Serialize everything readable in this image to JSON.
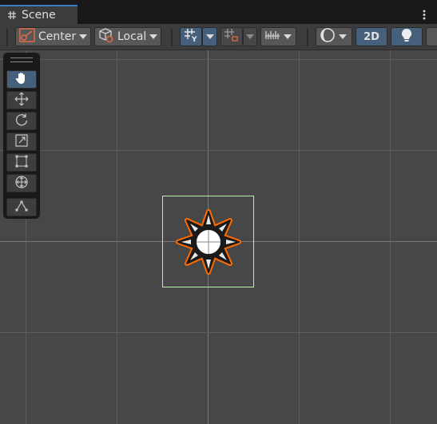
{
  "tab": {
    "title": "Scene",
    "icon": "grid-hash-icon"
  },
  "toolbar": {
    "pivot_label": "Center",
    "space_label": "Local",
    "mode_2d_label": "2D",
    "icons": [
      "pivot-center-icon",
      "local-space-icon",
      "grid-snap-icon",
      "increment-snap-icon",
      "gizmos-ruler-icon",
      "shading-mode-icon",
      "lighting-bulb-icon"
    ]
  },
  "tools": {
    "items": [
      "hand-tool",
      "move-tool",
      "rotate-tool",
      "scale-tool",
      "rect-tool",
      "transform-tool",
      "custom-editor-tool"
    ],
    "active": "hand-tool"
  },
  "colors": {
    "accent": "#3a79bb",
    "active_button": "#46607c",
    "selection_outline": "#b6f2a6",
    "sprite_outline": "#ff6a00",
    "scene_bg": "#474747"
  }
}
